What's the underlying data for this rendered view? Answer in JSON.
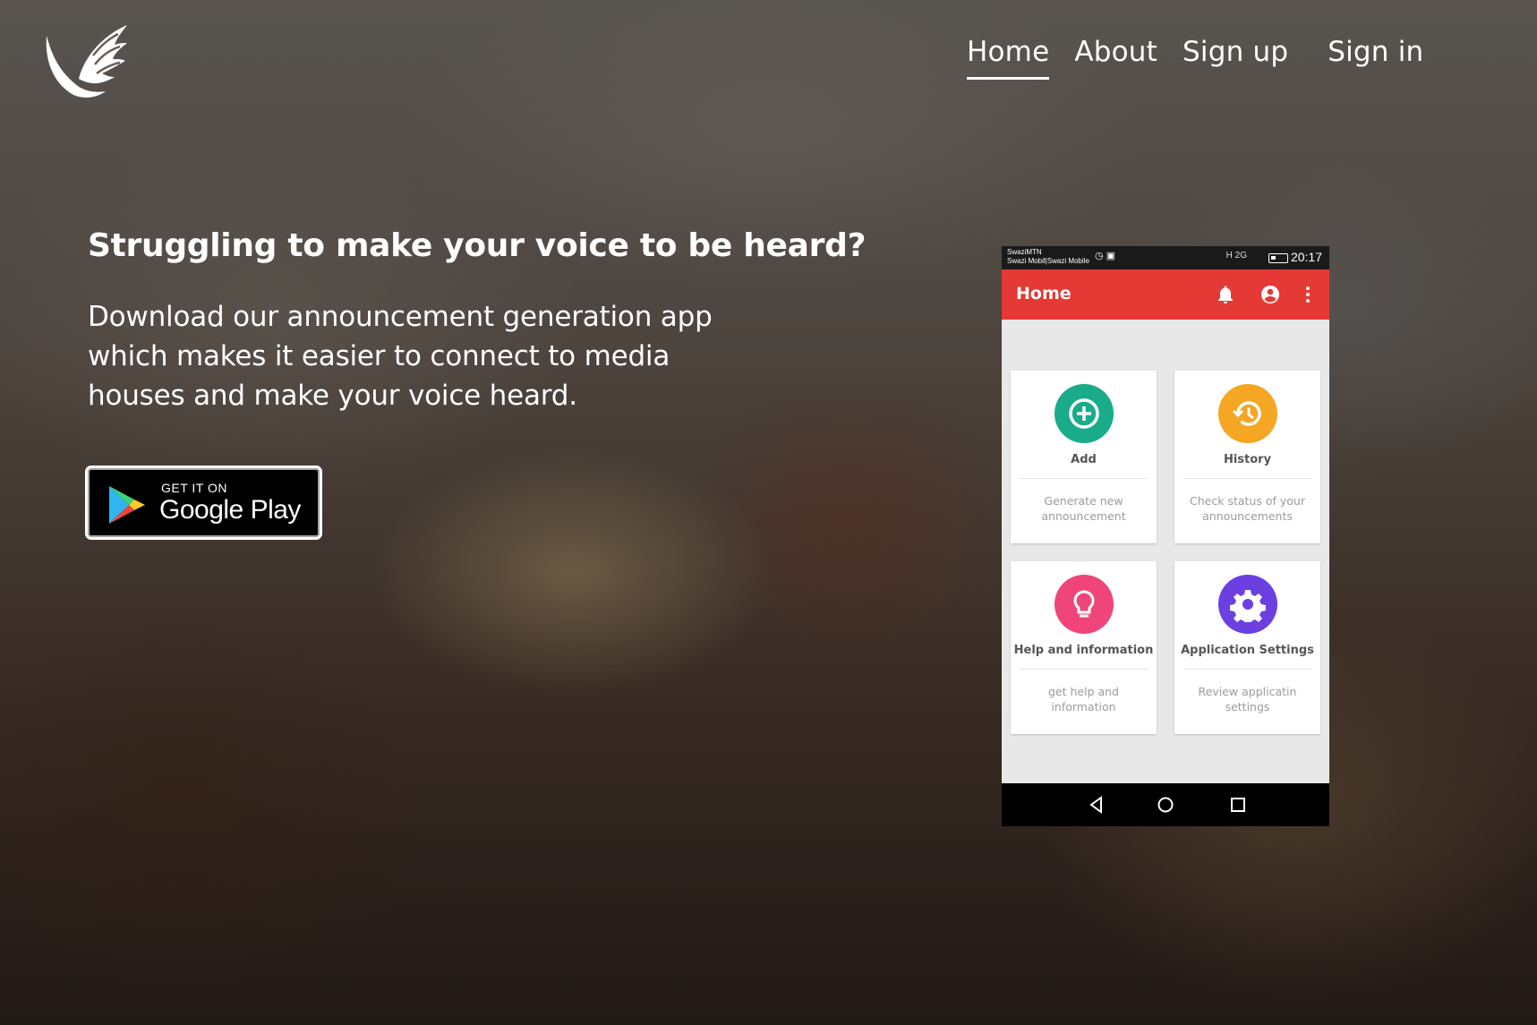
{
  "nav": {
    "items": [
      {
        "label": "Home",
        "active": true
      },
      {
        "label": "About",
        "active": false
      },
      {
        "label": "Sign up",
        "active": false
      },
      {
        "label": "Sign in",
        "active": false
      }
    ]
  },
  "hero": {
    "headline": "Struggling to make your voice to be heard?",
    "subtext": "Download our announcement generation app which makes it easier to connect to media houses and make your voice heard."
  },
  "badge": {
    "top_text": "GET IT ON",
    "store_name": "Google Play"
  },
  "phone": {
    "status": {
      "carrier_line1": "SwaziMTN",
      "carrier_line2": "Swazi Mobil|Swazi Mobile",
      "signal": "H 2G",
      "time": "20:17"
    },
    "appbar_title": "Home",
    "accent_color": "#e53935",
    "cards": [
      {
        "title": "Add",
        "desc": "Generate new announcement",
        "color": "#1aab8a",
        "icon": "add-circle-icon"
      },
      {
        "title": "History",
        "desc": "Check status of your announcements",
        "color": "#f5a623",
        "icon": "history-icon"
      },
      {
        "title": "Help and information",
        "desc": "get help and information",
        "color": "#f0457b",
        "icon": "lightbulb-icon"
      },
      {
        "title": "Application Settings",
        "desc": "Review  applicatin settings",
        "color": "#6b3fe0",
        "icon": "gear-icon"
      }
    ]
  }
}
